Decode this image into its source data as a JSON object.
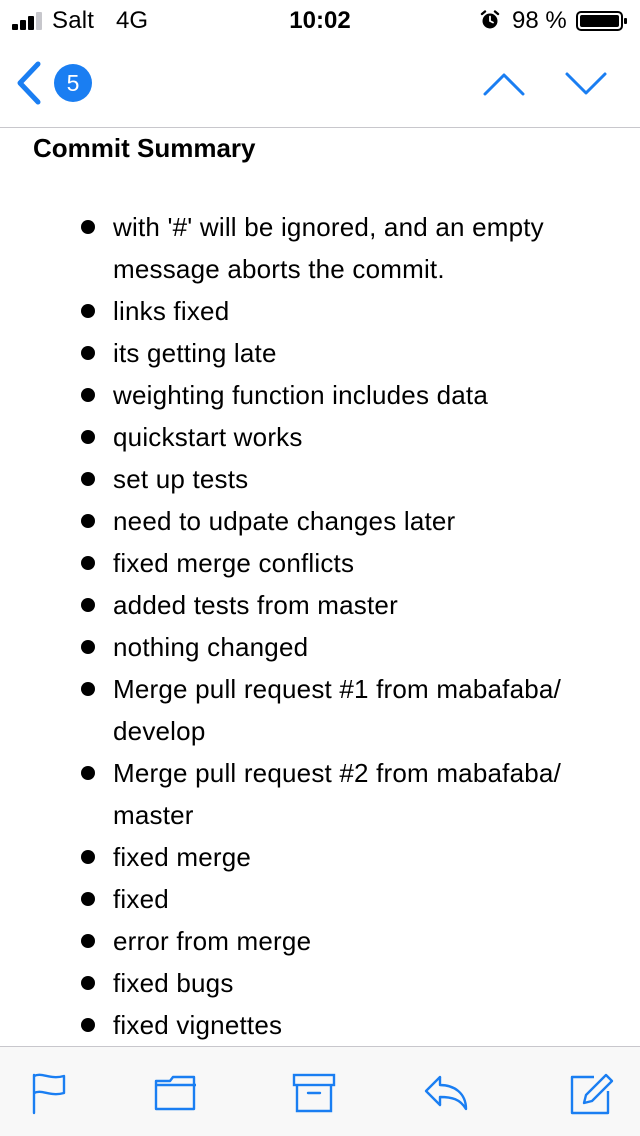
{
  "status_bar": {
    "carrier": "Salt",
    "network": "4G",
    "time": "10:02",
    "battery_percent": "98 %",
    "icons": [
      "signal-icon",
      "alarm-icon",
      "battery-icon"
    ]
  },
  "nav": {
    "unread_count": "5",
    "icons": [
      "back-chevron-icon",
      "chevron-up-icon",
      "chevron-down-icon"
    ],
    "accent_color": "#1a7ef2"
  },
  "message": {
    "title": "Commit Summary",
    "commits": [
      "with '#' will be ignored, and an empty message aborts the commit.",
      "links fixed",
      "its getting late",
      "weighting function includes data",
      "quickstart works",
      "set up tests",
      "need to udpate changes later",
      "fixed merge conflicts",
      "added tests from master",
      "nothing changed",
      "Merge pull request #1 from mabafaba/ develop",
      "Merge pull request #2 from mabafaba/ master",
      "fixed merge",
      "fixed",
      "error from merge",
      "fixed bugs",
      "fixed vignettes"
    ]
  },
  "toolbar": {
    "icons": [
      "flag-icon",
      "folder-icon",
      "archive-icon",
      "reply-icon",
      "compose-icon"
    ]
  }
}
